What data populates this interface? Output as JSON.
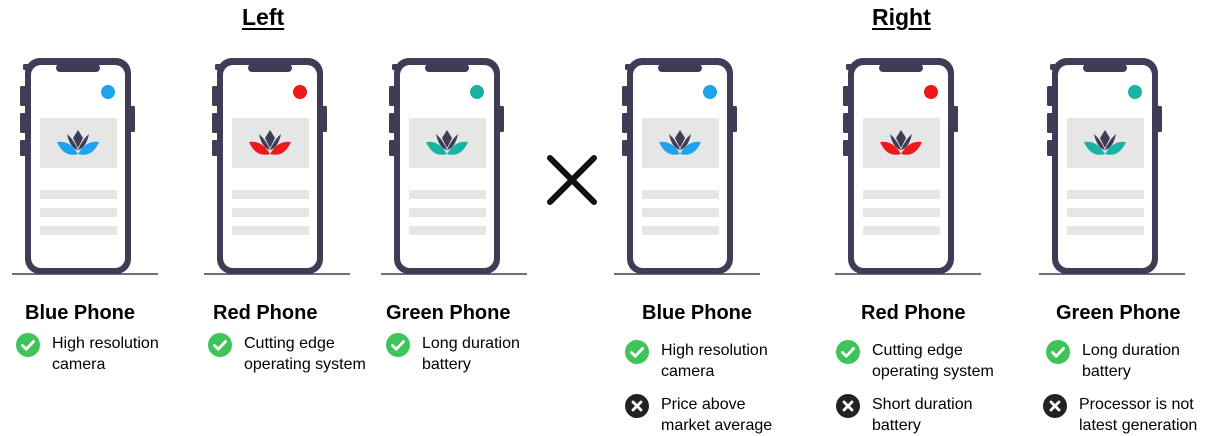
{
  "sections": {
    "left_title": "Left",
    "right_title": "Right"
  },
  "colors": {
    "phone_frame": "#3f3d56",
    "screen": "#ffffff",
    "image_box": "#e6e6e6",
    "text_lines": "#e6e6e6",
    "ground": "#3f3d56",
    "check": "#3ec55a",
    "cross": "#222222",
    "blue": "#1ea3f0",
    "red": "#ee1a1a",
    "green": "#19b3a2"
  },
  "left": {
    "phones": [
      {
        "name": "Blue Phone",
        "color": "#1ea3f0",
        "pros": [
          "High resolution\ncamera"
        ]
      },
      {
        "name": "Red Phone",
        "color": "#ee1a1a",
        "pros": [
          "Cutting edge\noperating system"
        ]
      },
      {
        "name": "Green Phone",
        "color": "#19b3a2",
        "pros": [
          "Long duration\nbattery"
        ]
      }
    ]
  },
  "right": {
    "phones": [
      {
        "name": "Blue Phone",
        "color": "#1ea3f0",
        "pros": [
          "High resolution\ncamera"
        ],
        "cons": [
          "Price above\nmarket average"
        ]
      },
      {
        "name": "Red Phone",
        "color": "#ee1a1a",
        "pros": [
          "Cutting edge\noperating system"
        ],
        "cons": [
          "Short duration\nbattery"
        ]
      },
      {
        "name": "Green Phone",
        "color": "#19b3a2",
        "pros": [
          "Long duration\nbattery"
        ],
        "cons": [
          "Processor is not\nlatest generation"
        ]
      }
    ]
  },
  "icons": {
    "pro": "check-circle-icon",
    "con": "x-circle-icon",
    "versus": "x-mark-icon"
  }
}
